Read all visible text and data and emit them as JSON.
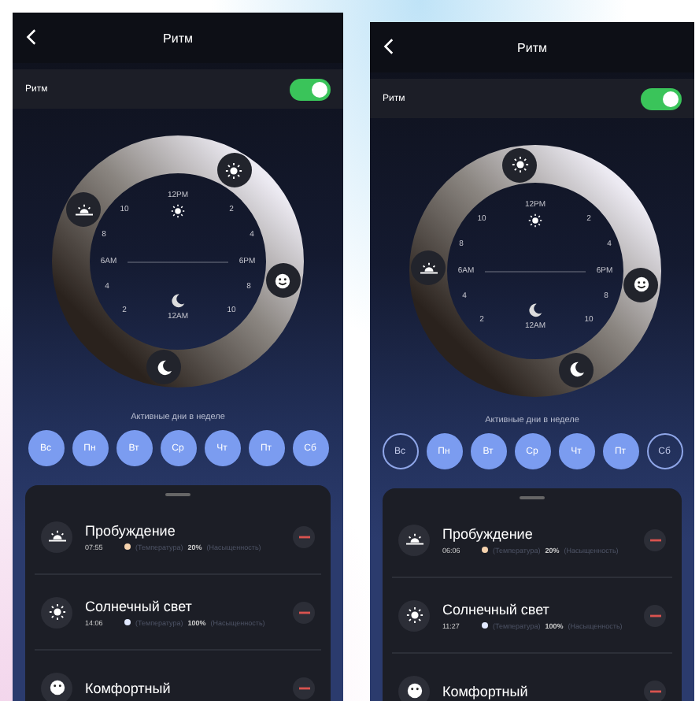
{
  "screens": [
    {
      "title": "Ритм",
      "toggle_label": "Ритм",
      "toggle_on": true,
      "dial": {
        "top_label": "12PM",
        "bottom_label": "12AM",
        "left_label": "6AM",
        "right_label": "6PM",
        "hours": [
          "10",
          "2",
          "8",
          "4",
          "4",
          "8",
          "2",
          "10"
        ]
      },
      "days_caption": "Активные дни в неделе",
      "days": [
        {
          "label": "Вс",
          "selected": true
        },
        {
          "label": "Пн",
          "selected": true
        },
        {
          "label": "Вт",
          "selected": true
        },
        {
          "label": "Ср",
          "selected": true
        },
        {
          "label": "Чт",
          "selected": true
        },
        {
          "label": "Пт",
          "selected": true
        },
        {
          "label": "Сб",
          "selected": true
        }
      ],
      "items": [
        {
          "kind": "sunrise",
          "title": "Пробуждение",
          "time": "07:55",
          "color": "#f6d3ae",
          "temperature": "(Температура)",
          "brightness": "20%",
          "saturation": "(Насыщенность)"
        },
        {
          "kind": "sun",
          "title": "Солнечный свет",
          "time": "14:06",
          "color": "#e2e9ff",
          "temperature": "(Температура)",
          "brightness": "100%",
          "saturation": "(Насыщенность)"
        },
        {
          "kind": "smile",
          "title": "Комфортный"
        }
      ]
    },
    {
      "title": "Ритм",
      "toggle_label": "Ритм",
      "toggle_on": true,
      "dial": {
        "top_label": "12PM",
        "bottom_label": "12AM",
        "left_label": "6AM",
        "right_label": "6PM",
        "hours": [
          "10",
          "2",
          "8",
          "4",
          "4",
          "8",
          "2",
          "10"
        ]
      },
      "days_caption": "Активные дни в неделе",
      "days": [
        {
          "label": "Вс",
          "selected": false
        },
        {
          "label": "Пн",
          "selected": true
        },
        {
          "label": "Вт",
          "selected": true
        },
        {
          "label": "Ср",
          "selected": true
        },
        {
          "label": "Чт",
          "selected": true
        },
        {
          "label": "Пт",
          "selected": true
        },
        {
          "label": "Сб",
          "selected": false
        }
      ],
      "items": [
        {
          "kind": "sunrise",
          "title": "Пробуждение",
          "time": "06:06",
          "color": "#f6d3ae",
          "temperature": "(Температура)",
          "brightness": "20%",
          "saturation": "(Насыщенность)"
        },
        {
          "kind": "sun",
          "title": "Солнечный свет",
          "time": "11:27",
          "color": "#e2e9ff",
          "temperature": "(Температура)",
          "brightness": "100%",
          "saturation": "(Насыщенность)"
        },
        {
          "kind": "smile",
          "title": "Комфортный"
        }
      ]
    }
  ]
}
